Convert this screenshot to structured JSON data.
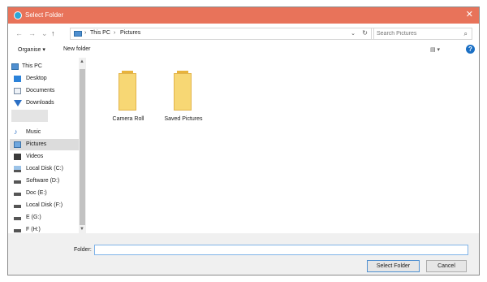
{
  "window": {
    "title": "Select Folder",
    "close_glyph": "✕",
    "icon": "app-icon"
  },
  "nav_buttons": {
    "back": "←",
    "forward": "→",
    "recent": "⌄",
    "up": "↑"
  },
  "address": {
    "path": [
      "This PC",
      "Pictures"
    ],
    "separator": "›",
    "dropdown": "⌄",
    "refresh": "↻"
  },
  "search": {
    "placeholder": "Search Pictures",
    "icon": "⌕"
  },
  "toolbar": {
    "organise": "Organise ▾",
    "new_folder": "New folder",
    "view_icon": "▤ ▾",
    "help": "?"
  },
  "sidebar": {
    "items": [
      {
        "label": "This PC",
        "icon": "pc-icon"
      },
      {
        "label": "Desktop",
        "icon": "desktop-icon"
      },
      {
        "label": "Documents",
        "icon": "documents-icon"
      },
      {
        "label": "Downloads",
        "icon": "downloads-icon"
      },
      {
        "label": "",
        "icon": "blank-icon"
      },
      {
        "label": "Music",
        "icon": "music-icon"
      },
      {
        "label": "Pictures",
        "icon": "pictures-icon",
        "selected": true
      },
      {
        "label": "Videos",
        "icon": "videos-icon"
      },
      {
        "label": "Local Disk (C:)",
        "icon": "drive-icon"
      },
      {
        "label": "Software (D:)",
        "icon": "drive-icon"
      },
      {
        "label": "Doc (E:)",
        "icon": "drive-icon"
      },
      {
        "label": "Local Disk (F:)",
        "icon": "drive-icon"
      },
      {
        "label": "E (G:)",
        "icon": "drive-icon"
      },
      {
        "label": "F (H:)",
        "icon": "drive-icon"
      }
    ],
    "scroll_up": "▲",
    "scroll_down": "▼"
  },
  "folders": [
    {
      "label": "Camera Roll"
    },
    {
      "label": "Saved Pictures"
    }
  ],
  "footer": {
    "folder_label": "Folder:",
    "folder_value": "",
    "select_button": "Select Folder",
    "cancel_button": "Cancel"
  },
  "colors": {
    "titlebar": "#e8735a",
    "folder": "#f7d774",
    "accent": "#1a6fc4",
    "selected_row": "#dcdcdc"
  }
}
